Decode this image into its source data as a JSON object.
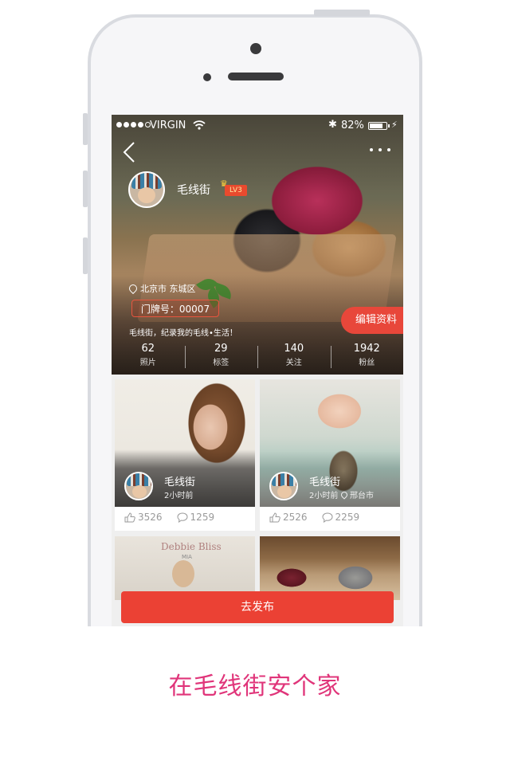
{
  "status_bar": {
    "carrier": "VIRGIN",
    "bluetooth_icon": "✱",
    "battery_percent": "82%",
    "battery_level": 0.82
  },
  "profile": {
    "name": "毛线街",
    "level": "LV3",
    "location": "北京市 东城区",
    "door_number": "门牌号：00007",
    "motto": "毛线街，纪录我的毛线•生活！",
    "edit_label": "编辑资料",
    "stats": [
      {
        "value": "62",
        "label": "照片"
      },
      {
        "value": "29",
        "label": "标签"
      },
      {
        "value": "140",
        "label": "关注"
      },
      {
        "value": "1942",
        "label": "粉丝"
      }
    ]
  },
  "feed": [
    {
      "author": "毛线街",
      "time": "2小时前",
      "location": "",
      "likes": "3526",
      "comments": "1259"
    },
    {
      "author": "毛线街",
      "time": "2小时前",
      "location": "邢台市",
      "likes": "2526",
      "comments": "2259"
    },
    {
      "partial_title": "Debbie Bliss",
      "partial_subtitle": "MIA"
    }
  ],
  "publish_label": "去发布",
  "tagline": "在毛线街安个家",
  "colors": {
    "accent": "#eb4134",
    "tagline": "#e0357a",
    "badge": "#e94a2e"
  },
  "icons": [
    "back-icon",
    "more-icon",
    "wifi-icon",
    "bluetooth-icon",
    "battery-icon",
    "location-pin-icon",
    "crown-icon",
    "like-icon",
    "comment-icon"
  ]
}
